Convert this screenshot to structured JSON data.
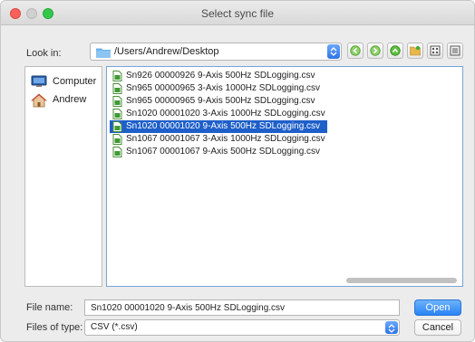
{
  "window": {
    "title": "Select sync file"
  },
  "toolbar": {
    "look_in_label": "Look in:",
    "path": "/Users/Andrew/Desktop",
    "buttons": [
      "back-icon",
      "forward-icon",
      "parent-folder-icon",
      "new-folder-icon",
      "list-view-icon",
      "detail-view-icon"
    ]
  },
  "sidebar": {
    "items": [
      {
        "label": "Computer",
        "icon": "computer-icon"
      },
      {
        "label": "Andrew",
        "icon": "home-icon"
      }
    ]
  },
  "files": [
    "Sn926 00000926 9-Axis 500Hz SDLogging.csv",
    "Sn965 00000965 3-Axis 1000Hz SDLogging.csv",
    "Sn965 00000965 9-Axis 500Hz SDLogging.csv",
    "Sn1020 00001020 3-Axis 1000Hz SDLogging.csv",
    "Sn1020 00001020 9-Axis 500Hz SDLogging.csv",
    "Sn1067 00001067 3-Axis 1000Hz SDLogging.csv",
    "Sn1067 00001067 9-Axis 500Hz SDLogging.csv"
  ],
  "selected_file_index": 4,
  "form": {
    "file_name_label": "File name:",
    "file_name_value": "Sn1020 00001020 9-Axis 500Hz SDLogging.csv",
    "file_type_label": "Files of type:",
    "file_type_value": "CSV (*.csv)"
  },
  "buttons": {
    "open": "Open",
    "cancel": "Cancel"
  },
  "colors": {
    "selection": "#1e5fc9",
    "accent": "#2a82f6",
    "close": "#fc605c",
    "zoom": "#34c84a"
  }
}
